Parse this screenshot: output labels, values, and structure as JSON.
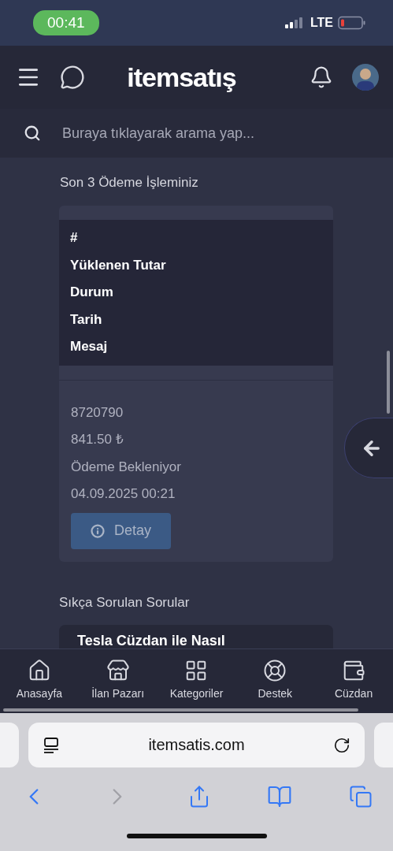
{
  "status_bar": {
    "time": "00:41",
    "network": "LTE",
    "battery_low": true
  },
  "header": {
    "logo": "itemsatış"
  },
  "search": {
    "placeholder": "Buraya tıklayarak arama yap..."
  },
  "payments": {
    "title": "Son 3 Ödeme İşleminiz",
    "columns": [
      "#",
      "Yüklenen Tutar",
      "Durum",
      "Tarih",
      "Mesaj"
    ],
    "rows": [
      {
        "cells": [
          "8720790",
          "841.50 ₺",
          "Ödeme Bekleniyor",
          "04.09.2025 00:21"
        ],
        "button": "Detay"
      }
    ]
  },
  "faq": {
    "title": "Sıkça Sorulan Sorular",
    "items": [
      {
        "title": "Tesla Cüzdan ile Nasıl"
      }
    ]
  },
  "bottom_nav": [
    {
      "label": "Anasayfa"
    },
    {
      "label": "İlan Pazarı"
    },
    {
      "label": "Kategoriler"
    },
    {
      "label": "Destek"
    },
    {
      "label": "Cüzdan"
    }
  ],
  "browser": {
    "url": "itemsatis.com"
  }
}
